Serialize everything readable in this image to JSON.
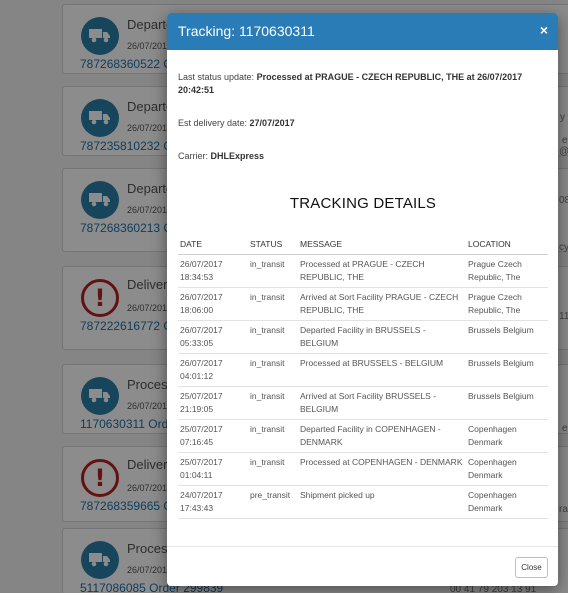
{
  "background_cards": [
    {
      "icon": "truck-icon",
      "title": "Departe",
      "date": "26/07/201",
      "ref": "787268360522 O"
    },
    {
      "icon": "truck-icon",
      "title": "Departe",
      "date": "26/07/201",
      "ref": "787235810232 O"
    },
    {
      "icon": "truck-icon",
      "title": "Departe",
      "date": "26/07/201",
      "ref": "787268360213 O"
    },
    {
      "icon": "alert-icon",
      "title": "Delivery",
      "date": "26/07/201",
      "ref": "787222616772 O"
    },
    {
      "icon": "truck-icon",
      "title": "Processe",
      "date": "26/07/201",
      "ref": "1170630311 Ord"
    },
    {
      "icon": "alert-icon",
      "title": "Delivery",
      "date": "26/07/201",
      "ref": "787268359665 O"
    },
    {
      "icon": "truck-icon",
      "title": "Processe",
      "date": "26/07/201",
      "ref": "5117086085 Order 299839"
    }
  ],
  "background_fragments": [
    "y",
    "e",
    "@",
    "08",
    "cyb",
    "11",
    "e",
    "ra",
    "00 41 79 203 13 91"
  ],
  "modal": {
    "title": "Tracking: 1170630311",
    "close_icon": "×",
    "last_status_label": "Last status update: ",
    "last_status_value": "Processed at PRAGUE - CZECH REPUBLIC, THE at 26/07/2017 20:42:51",
    "est_delivery_label": "Est delivery date: ",
    "est_delivery_value": "27/07/2017",
    "carrier_label": "Carrier: ",
    "carrier_value": "DHLExpress",
    "section_title": "TRACKING DETAILS",
    "columns": [
      "DATE",
      "STATUS",
      "MESSAGE",
      "LOCATION"
    ],
    "rows": [
      {
        "date": "26/07/2017",
        "time": "18:34:53",
        "status": "in_transit",
        "message": "Processed at PRAGUE - CZECH REPUBLIC, THE",
        "location": "Prague Czech Republic, The"
      },
      {
        "date": "26/07/2017",
        "time": "18:06:00",
        "status": "in_transit",
        "message": "Arrived at Sort Facility PRAGUE - CZECH REPUBLIC, THE",
        "location": "Prague Czech Republic, The"
      },
      {
        "date": "26/07/2017",
        "time": "05:33:05",
        "status": "in_transit",
        "message": "Departed Facility in BRUSSELS - BELGIUM",
        "location": "Brussels Belgium"
      },
      {
        "date": "26/07/2017",
        "time": "04:01:12",
        "status": "in_transit",
        "message": "Processed at BRUSSELS - BELGIUM",
        "location": "Brussels Belgium"
      },
      {
        "date": "25/07/2017",
        "time": "21:19:05",
        "status": "in_transit",
        "message": "Arrived at Sort Facility BRUSSELS - BELGIUM",
        "location": "Brussels Belgium"
      },
      {
        "date": "25/07/2017",
        "time": "07:16:45",
        "status": "in_transit",
        "message": "Departed Facility in COPENHAGEN - DENMARK",
        "location": "Copenhagen Denmark"
      },
      {
        "date": "25/07/2017",
        "time": "01:04:11",
        "status": "in_transit",
        "message": "Processed at COPENHAGEN - DENMARK",
        "location": "Copenhagen Denmark"
      },
      {
        "date": "24/07/2017",
        "time": "17:43:43",
        "status": "pre_transit",
        "message": "Shipment picked up",
        "location": "Copenhagen Denmark"
      }
    ],
    "close_button": "Close"
  },
  "colors": {
    "header": "#2a7cb6",
    "link": "#1f6fa8",
    "alert": "#b51f1f",
    "truck": "#2a7fa8"
  }
}
